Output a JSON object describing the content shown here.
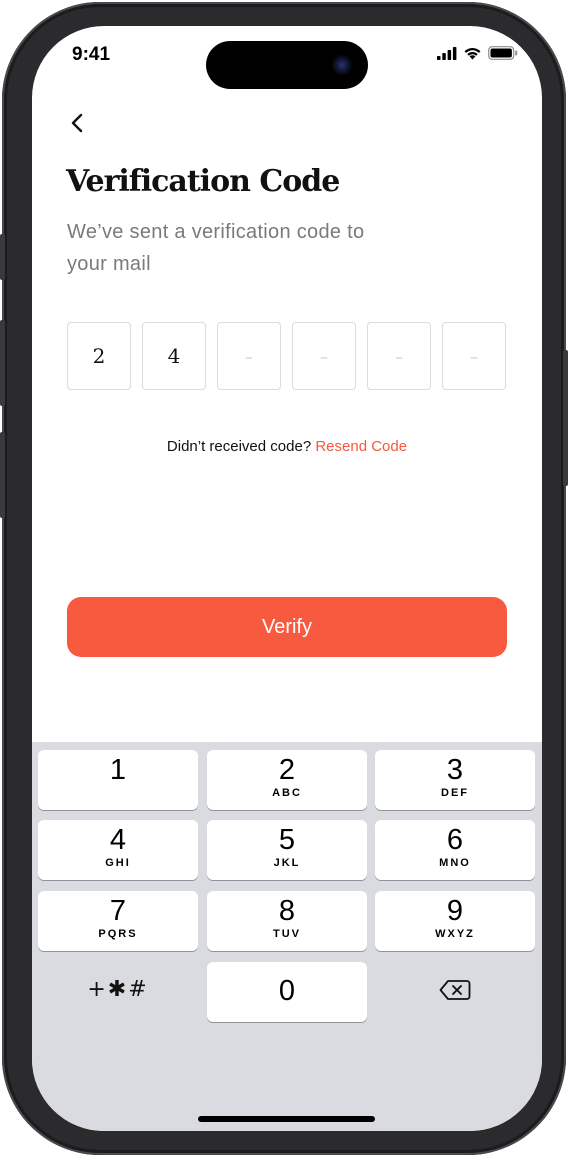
{
  "status_bar": {
    "time": "9:41",
    "icons": [
      "cellular-signal-icon",
      "wifi-icon",
      "battery-icon"
    ]
  },
  "nav": {
    "back_icon": "chevron-left-icon"
  },
  "header": {
    "title": "Verification Code",
    "subtitle": "We’ve sent a verification code to your mail"
  },
  "code": {
    "digits": [
      "2",
      "4",
      "–",
      "–",
      "–",
      "–"
    ]
  },
  "resend": {
    "prompt": "Didn’t received code?",
    "link": "Resend Code"
  },
  "verify_button": {
    "label": "Verify"
  },
  "keypad": {
    "keys": [
      {
        "digit": "1",
        "letters": ""
      },
      {
        "digit": "2",
        "letters": "ABC"
      },
      {
        "digit": "3",
        "letters": "DEF"
      },
      {
        "digit": "4",
        "letters": "GHI"
      },
      {
        "digit": "5",
        "letters": "JKL"
      },
      {
        "digit": "6",
        "letters": "MNO"
      },
      {
        "digit": "7",
        "letters": "PQRS"
      },
      {
        "digit": "8",
        "letters": "TUV"
      },
      {
        "digit": "9",
        "letters": "WXYZ"
      },
      {
        "digit": "0",
        "letters": ""
      }
    ],
    "symbols_label": "+✱#",
    "delete_icon": "backspace-icon"
  },
  "colors": {
    "accent": "#F85A3F",
    "keypad_bg": "#D9DBE1",
    "subtitle": "#7A7A7A"
  }
}
